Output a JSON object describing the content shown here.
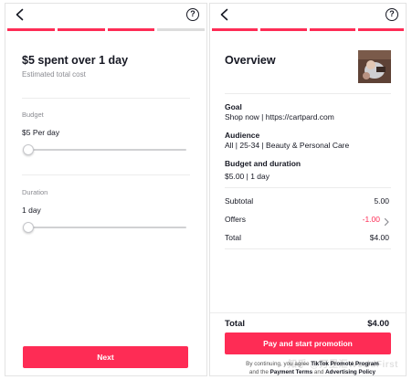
{
  "left": {
    "progress": [
      true,
      true,
      true,
      false
    ],
    "title": "$5 spent over 1 day",
    "subtitle": "Estimated total cost",
    "budget": {
      "label": "Budget",
      "value": "$5 Per day",
      "slider_level": 0
    },
    "duration": {
      "label": "Duration",
      "value": "1 day",
      "slider_level": 0
    },
    "next_label": "Next"
  },
  "right": {
    "progress": [
      true,
      true,
      true,
      true
    ],
    "title": "Overview",
    "goal": {
      "title": "Goal",
      "value": "Shop now | https://cartpard.com"
    },
    "audience": {
      "title": "Audience",
      "value": "All | 25-34 | Beauty & Personal Care"
    },
    "budget_duration": {
      "title": "Budget and duration",
      "value": "$5.00 | 1 day"
    },
    "summary": [
      {
        "label": "Subtotal",
        "value": "5.00",
        "accent": false
      },
      {
        "label": "Offers",
        "value": "-1.00",
        "accent": true
      },
      {
        "label": "Total",
        "value": "$4.00",
        "accent": false
      }
    ],
    "footer_total_label": "Total",
    "footer_total_value": "$4.00",
    "pay_label": "Pay and start promotion",
    "terms": {
      "line1_prefix": "By continuing, you agree",
      "line1_link": "TikTok Promote Program",
      "line2_prefix": "and the",
      "payment_terms": "Payment Terms",
      "line2_and": "and",
      "advertising_policy": "Advertising Policy"
    },
    "watermark": "知乎 @万里汇WorldFirst"
  },
  "colors": {
    "accent": "#fe2c55",
    "text": "#161823",
    "muted": "#8a8b91"
  }
}
